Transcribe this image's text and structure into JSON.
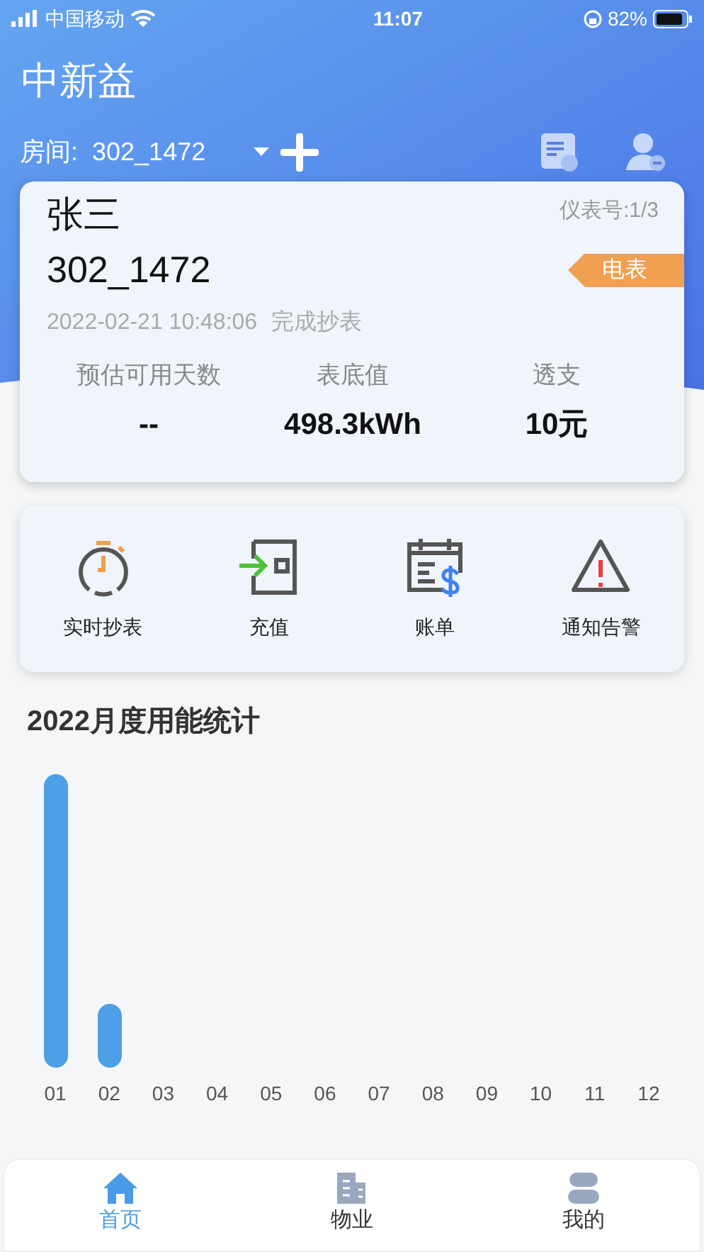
{
  "status_bar": {
    "carrier": "中国移动",
    "time": "11:07",
    "battery": "82%"
  },
  "app_title": "中新益",
  "room": {
    "label": "房间:",
    "value": "302_1472"
  },
  "meter_card": {
    "name": "张三",
    "room": "302_1472",
    "meter_no": "仪表号:1/3",
    "tag": "电表",
    "reading_time": "2022-02-21 10:48:06",
    "status": "完成抄表",
    "stats": [
      {
        "label": "预估可用天数",
        "value": "--"
      },
      {
        "label": "表底值",
        "value": "498.3kWh"
      },
      {
        "label": "透支",
        "value": "10元"
      }
    ]
  },
  "actions": [
    {
      "kind": "timer",
      "label": "实时抄表"
    },
    {
      "kind": "recharge",
      "label": "充值"
    },
    {
      "kind": "bill",
      "label": "账单"
    },
    {
      "kind": "alert",
      "label": "通知告警"
    }
  ],
  "chart": {
    "title": "2022月度用能统计",
    "months": [
      "01",
      "02",
      "03",
      "04",
      "05",
      "06",
      "07",
      "08",
      "09",
      "10",
      "11",
      "12"
    ]
  },
  "tab_bar": [
    {
      "kind": "home",
      "label": "首页",
      "selected": true
    },
    {
      "kind": "property",
      "label": "物业",
      "selected": false
    },
    {
      "kind": "mine",
      "label": "我的",
      "selected": false
    }
  ]
}
